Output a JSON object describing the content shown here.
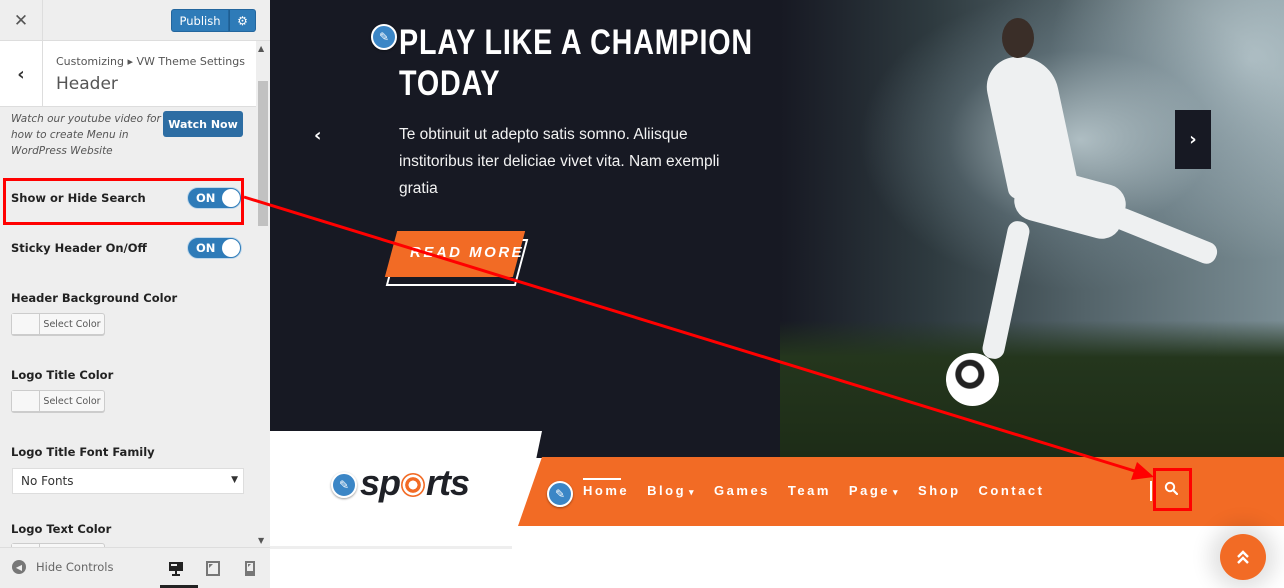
{
  "customizer": {
    "close_icon": "✕",
    "publish_label": "Publish",
    "settings_icon": "⚙",
    "back_icon": "‹",
    "breadcrumb": "Customizing ▸ VW Theme Settings",
    "section_title": "Header",
    "watch_text": "Watch our youtube video for how to create Menu in WordPress Website",
    "watch_button": "Watch Now",
    "options": {
      "show_hide_search": {
        "label": "Show or Hide Search",
        "state": "ON"
      },
      "sticky_header": {
        "label": "Sticky Header On/Off",
        "state": "ON"
      },
      "header_bg_color": {
        "label": "Header Background Color",
        "button": "Select Color"
      },
      "logo_title_color": {
        "label": "Logo Title Color",
        "button": "Select Color"
      },
      "logo_title_font_family": {
        "label": "Logo Title Font Family",
        "selected": "No Fonts"
      },
      "logo_text_color": {
        "label": "Logo Text Color"
      }
    },
    "footer": {
      "hide_controls": "Hide Controls",
      "devices": [
        "desktop",
        "tablet",
        "mobile"
      ],
      "active_device": "desktop"
    }
  },
  "preview": {
    "hero": {
      "title": "PLAY LIKE A CHAMPION TODAY",
      "title_line1": "PLAY LIKE A CHAMPION",
      "title_line2": "TODAY",
      "text": "Te obtinuit ut adepto satis somno. Aliisque institoribus iter deliciae vivet vita. Nam exempli gratia",
      "button": "READ MORE",
      "prev_icon": "‹",
      "next_icon": "›"
    },
    "logo": {
      "text_before": "sp",
      "text_after": "rts"
    },
    "nav": {
      "items": [
        {
          "label": "Home",
          "active": true,
          "dropdown": false
        },
        {
          "label": "Blog",
          "active": false,
          "dropdown": true
        },
        {
          "label": "Games",
          "active": false,
          "dropdown": false
        },
        {
          "label": "Team",
          "active": false,
          "dropdown": false
        },
        {
          "label": "Page",
          "active": false,
          "dropdown": true
        },
        {
          "label": "Shop",
          "active": false,
          "dropdown": false
        },
        {
          "label": "Contact",
          "active": false,
          "dropdown": false
        }
      ],
      "caret_icon": "▾",
      "search_icon": "🔍"
    },
    "scroll_top_icon": "︽",
    "edit_icon": "✎"
  },
  "colors": {
    "accent_orange": "#f26b25",
    "hero_dark": "#171923",
    "wp_blue": "#2e7bb8",
    "annotation_red": "#ff0000"
  }
}
